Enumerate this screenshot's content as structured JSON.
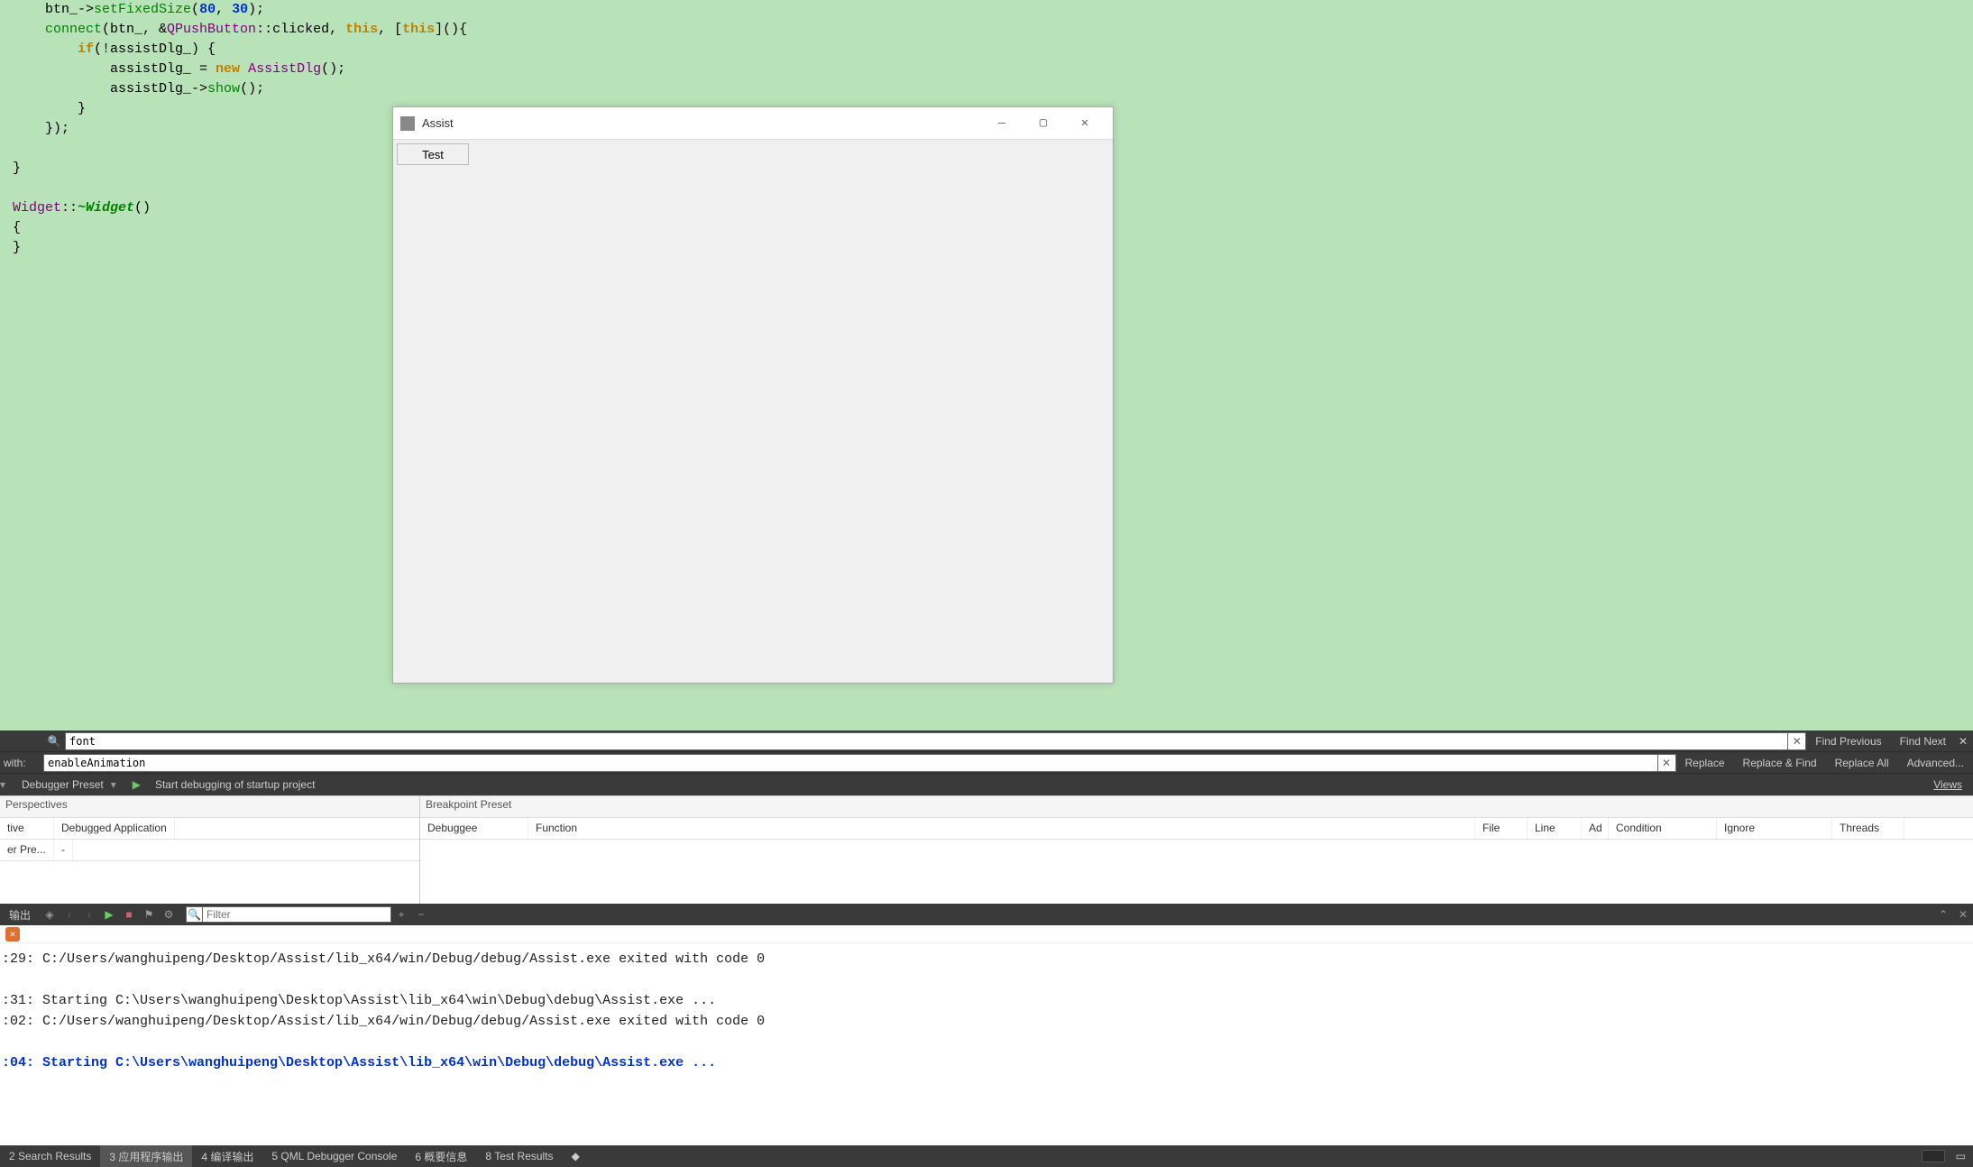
{
  "code_lines_html": [
    "    btn_-><span class='kw-green'>setFixedSize</span>(<span class='kw-blue'>80</span>, <span class='kw-blue'>30</span>);",
    "    <span class='kw-green'>connect</span>(btn_, &<span class='kw-purple'>QPushButton</span>::clicked, <span class='kw-orange'>this</span>, [<span class='kw-orange'>this</span>](){",
    "        <span class='kw-orange'>if</span>(!assistDlg_) {",
    "            assistDlg_ = <span class='kw-orange'>new</span> <span class='kw-purple'>AssistDlg</span>();",
    "            assistDlg_-><span class='kw-green'>show</span>();",
    "        }",
    "    });",
    "",
    "}",
    "",
    "<span class='kw-purple'>Widget</span>::<span class='kw-italic'>~Widget</span>()",
    "{",
    "}"
  ],
  "app_window": {
    "title": "Assist",
    "test_button": "Test"
  },
  "find": {
    "search_value": "font",
    "replace_label": "with:",
    "replace_value": "enableAnimation",
    "buttons": {
      "find_prev": "Find Previous",
      "find_next": "Find Next",
      "replace": "Replace",
      "replace_find": "Replace & Find",
      "replace_all": "Replace All",
      "advanced": "Advanced..."
    }
  },
  "debug_bar": {
    "preset": "Debugger Preset",
    "start": "Start debugging of startup project",
    "views": "Views"
  },
  "perspectives": {
    "left_header": "Perspectives",
    "right_header": "Breakpoint Preset",
    "left_cols": [
      "tive",
      "Debugged Application"
    ],
    "left_row": [
      "er Pre...",
      "-"
    ],
    "right_cols": [
      "Debuggee",
      "Function",
      "File",
      "Line",
      "Ad",
      "Condition",
      "Ignore",
      "Threads"
    ]
  },
  "output": {
    "label": "输出",
    "filter_placeholder": "Filter",
    "lines": [
      ":29: C:/Users/wanghuipeng/Desktop/Assist/lib_x64/win/Debug/debug/Assist.exe exited with code 0",
      "",
      ":31: Starting C:\\Users\\wanghuipeng\\Desktop\\Assist\\lib_x64\\win\\Debug\\debug\\Assist.exe ...",
      ":02: C:/Users/wanghuipeng/Desktop/Assist/lib_x64/win/Debug/debug/Assist.exe exited with code 0",
      ""
    ],
    "bold_line": ":04: Starting C:\\Users\\wanghuipeng\\Desktop\\Assist\\lib_x64\\win\\Debug\\debug\\Assist.exe ..."
  },
  "bottom_tabs": [
    "2 Search Results",
    "3 应用程序输出",
    "4 编译输出",
    "5 QML Debugger Console",
    "6 概要信息",
    "8 Test Results"
  ],
  "bottom_active_index": 1,
  "bottom_arrow": "◆"
}
